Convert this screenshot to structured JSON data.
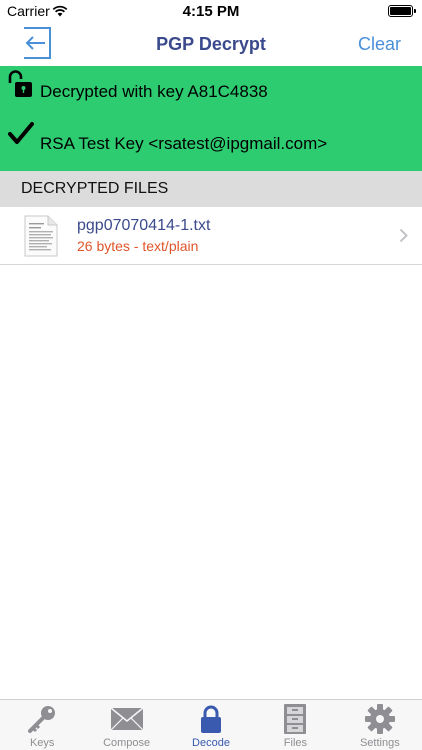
{
  "status_bar": {
    "carrier": "Carrier",
    "time": "4:15 PM"
  },
  "nav": {
    "title": "PGP Decrypt",
    "right_action": "Clear",
    "back_icon": "exit-arrow-icon"
  },
  "result": {
    "status": "Decrypted with key A81C4838",
    "key_owner": "RSA Test Key <rsatest@ipgmail.com>",
    "background_color": "#2ecc71"
  },
  "section": {
    "title": "DECRYPTED FILES"
  },
  "files": [
    {
      "name": "pgp07070414-1.txt",
      "meta": "26 bytes - text/plain"
    }
  ],
  "tabs": [
    {
      "label": "Keys",
      "icon": "key-icon",
      "active": false
    },
    {
      "label": "Compose",
      "icon": "envelope-icon",
      "active": false
    },
    {
      "label": "Decode",
      "icon": "lock-icon",
      "active": true
    },
    {
      "label": "Files",
      "icon": "file-cabinet-icon",
      "active": false
    },
    {
      "label": "Settings",
      "icon": "gear-icon",
      "active": false
    }
  ],
  "colors": {
    "accent": "#4a90d9",
    "title": "#3a4a8c",
    "active_tab": "#3a5ab0",
    "meta": "#e0552a"
  }
}
